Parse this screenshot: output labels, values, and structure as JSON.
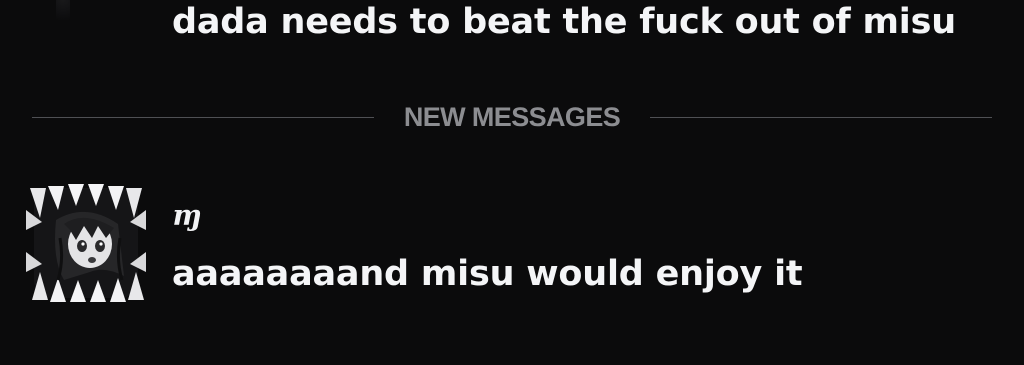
{
  "previous_message": {
    "text": "dada needs to beat the fuck out of misu"
  },
  "divider": {
    "label": "NEW MESSAGES"
  },
  "message": {
    "author": "ɱ",
    "text": "aaaaaaaand misu would enjoy it",
    "avatar_icon": "anime-girl-fangs-avatar"
  },
  "colors": {
    "background": "#0b0b0c",
    "text": "#f4f5f7",
    "divider_line": "#4f5054",
    "divider_label": "#8c8d91"
  }
}
